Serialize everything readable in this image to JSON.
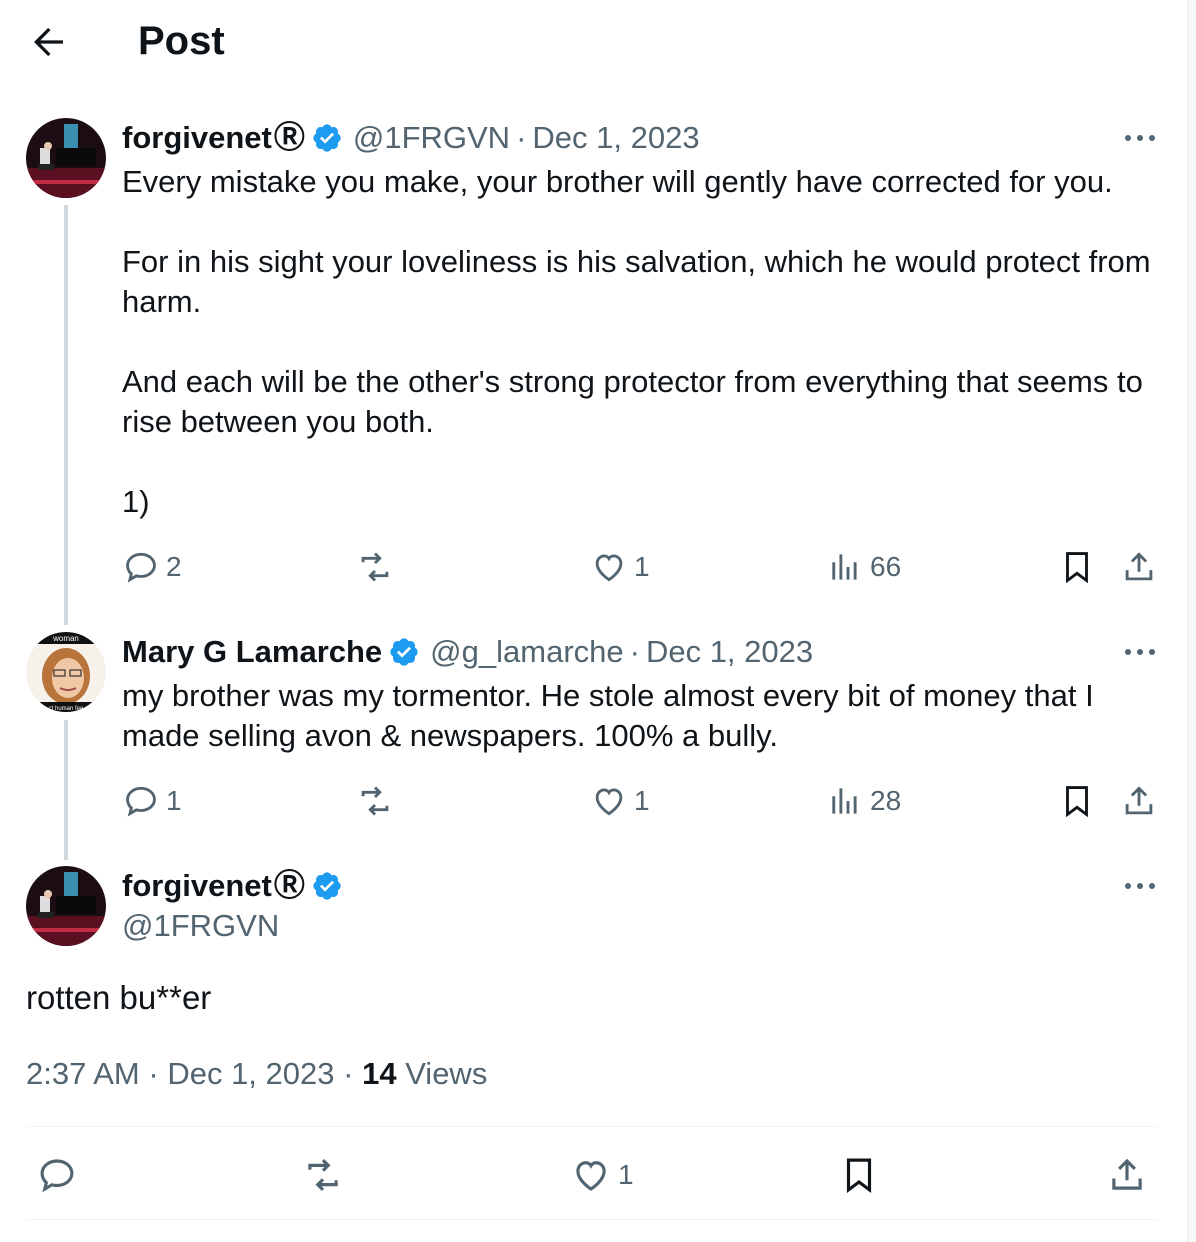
{
  "header": {
    "title": "Post"
  },
  "colors": {
    "verified": "#1d9bf0",
    "text": "#0f1419",
    "secondary": "#536471",
    "thread_line": "#cfd9de"
  },
  "tweet1": {
    "name": "forgivenet",
    "reg_mark": "Ⓡ",
    "handle": "@1FRGVN",
    "separator": "·",
    "date": "Dec 1, 2023",
    "text": "Every mistake you make, your brother will gently have corrected for you.\n\nFor in his sight your loveliness is his salvation, which he would protect from harm.\n\nAnd each will be the other's strong protector from everything that seems to rise between you both.\n\n1)",
    "replies": "2",
    "likes": "1",
    "views": "66"
  },
  "tweet2": {
    "name": "Mary G Lamarche",
    "handle": "@g_lamarche",
    "separator": "·",
    "date": "Dec 1, 2023",
    "avatar_caption_top": "woman",
    "avatar_caption_bottom": "ct human fee",
    "text": "my brother was my tormentor. He stole almost every bit of money that I made selling avon & newspapers. 100% a bully.",
    "replies": "1",
    "likes": "1",
    "views": "28"
  },
  "main_tweet": {
    "name": "forgivenet",
    "reg_mark": "Ⓡ",
    "handle": "@1FRGVN",
    "text": "rotten bu**er",
    "time": "2:37 AM",
    "separator": "·",
    "date": "Dec 1, 2023",
    "separator2": "·",
    "views_count": "14",
    "views_label": "Views",
    "likes": "1"
  }
}
